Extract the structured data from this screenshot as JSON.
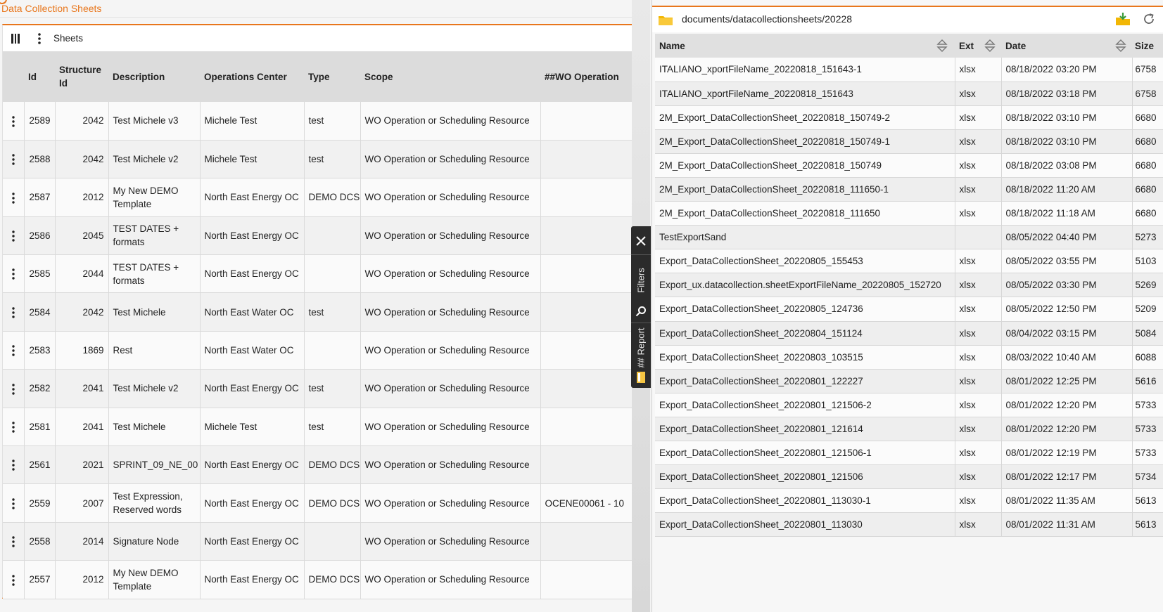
{
  "app": {
    "title": "Data Collection Sheets"
  },
  "toolbar": {
    "title": "Sheets"
  },
  "sheets": {
    "columns": [
      "Id",
      "Structure Id",
      "Description",
      "Operations Center",
      "Type",
      "Scope",
      "##WO Operation"
    ],
    "rows": [
      [
        "2589",
        "2042",
        "Test Michele v3",
        "Michele Test",
        "test",
        "WO Operation or Scheduling Resource",
        ""
      ],
      [
        "2588",
        "2042",
        "Test Michele v2",
        "Michele Test",
        "test",
        "WO Operation or Scheduling Resource",
        ""
      ],
      [
        "2587",
        "2012",
        "My New DEMO Template",
        "North East Energy OC",
        "DEMO DCS",
        "WO Operation or Scheduling Resource",
        ""
      ],
      [
        "2586",
        "2045",
        "TEST DATES + formats",
        "North East Energy OC",
        "",
        "WO Operation or Scheduling Resource",
        ""
      ],
      [
        "2585",
        "2044",
        "TEST DATES + formats",
        "North East Energy OC",
        "",
        "WO Operation or Scheduling Resource",
        ""
      ],
      [
        "2584",
        "2042",
        "Test Michele",
        "North East Water OC",
        "test",
        "WO Operation or Scheduling Resource",
        ""
      ],
      [
        "2583",
        "1869",
        "Rest",
        "North East Water OC",
        "",
        "WO Operation or Scheduling Resource",
        ""
      ],
      [
        "2582",
        "2041",
        "Test Michele v2",
        "North East Energy OC",
        "test",
        "WO Operation or Scheduling Resource",
        ""
      ],
      [
        "2581",
        "2041",
        "Test Michele",
        "Michele Test",
        "test",
        "WO Operation or Scheduling Resource",
        ""
      ],
      [
        "2561",
        "2021",
        "SPRINT_09_NE_00",
        "North East Energy OC",
        "DEMO DCS",
        "WO Operation or Scheduling Resource",
        ""
      ],
      [
        "2559",
        "2007",
        "Test Expression, Reserved words",
        "North East Energy OC",
        "DEMO DCS",
        "WO Operation or Scheduling Resource",
        "OCENE00061 - 10"
      ],
      [
        "2558",
        "2014",
        "Signature Node",
        "North East Energy OC",
        "",
        "WO Operation or Scheduling Resource",
        ""
      ],
      [
        "2557",
        "2012",
        "My New DEMO Template",
        "North East Energy OC",
        "DEMO DCS",
        "WO Operation or Scheduling Resource",
        ""
      ]
    ]
  },
  "side_tabs": {
    "filters": "Filters",
    "report": "## Report"
  },
  "file_browser": {
    "path": "documents/datacollectionsheets/20228",
    "columns": [
      "Name",
      "Ext",
      "Date",
      "Size"
    ],
    "rows": [
      [
        "ITALIANO_xportFileName_20220818_151643-1",
        "xlsx",
        "08/18/2022 03:20 PM",
        "6758"
      ],
      [
        "ITALIANO_xportFileName_20220818_151643",
        "xlsx",
        "08/18/2022 03:18 PM",
        "6758"
      ],
      [
        "2M_Export_DataCollectionSheet_20220818_150749-2",
        "xlsx",
        "08/18/2022 03:10 PM",
        "6680"
      ],
      [
        "2M_Export_DataCollectionSheet_20220818_150749-1",
        "xlsx",
        "08/18/2022 03:10 PM",
        "6680"
      ],
      [
        "2M_Export_DataCollectionSheet_20220818_150749",
        "xlsx",
        "08/18/2022 03:08 PM",
        "6680"
      ],
      [
        "2M_Export_DataCollectionSheet_20220818_111650-1",
        "xlsx",
        "08/18/2022 11:20 AM",
        "6680"
      ],
      [
        "2M_Export_DataCollectionSheet_20220818_111650",
        "xlsx",
        "08/18/2022 11:18 AM",
        "6680"
      ],
      [
        "TestExportSand",
        "",
        "08/05/2022 04:40 PM",
        "5273"
      ],
      [
        "Export_DataCollectionSheet_20220805_155453",
        "xlsx",
        "08/05/2022 03:55 PM",
        "5103"
      ],
      [
        "Export_ux.datacollection.sheetExportFileName_20220805_152720",
        "xlsx",
        "08/05/2022 03:30 PM",
        "5269"
      ],
      [
        "Export_DataCollectionSheet_20220805_124736",
        "xlsx",
        "08/05/2022 12:50 PM",
        "5209"
      ],
      [
        "Export_DataCollectionSheet_20220804_151124",
        "xlsx",
        "08/04/2022 03:15 PM",
        "5084"
      ],
      [
        "Export_DataCollectionSheet_20220803_103515",
        "xlsx",
        "08/03/2022 10:40 AM",
        "6088"
      ],
      [
        "Export_DataCollectionSheet_20220801_122227",
        "xlsx",
        "08/01/2022 12:25 PM",
        "5616"
      ],
      [
        "Export_DataCollectionSheet_20220801_121506-2",
        "xlsx",
        "08/01/2022 12:20 PM",
        "5733"
      ],
      [
        "Export_DataCollectionSheet_20220801_121614",
        "xlsx",
        "08/01/2022 12:20 PM",
        "5733"
      ],
      [
        "Export_DataCollectionSheet_20220801_121506-1",
        "xlsx",
        "08/01/2022 12:19 PM",
        "5733"
      ],
      [
        "Export_DataCollectionSheet_20220801_121506",
        "xlsx",
        "08/01/2022 12:17 PM",
        "5734"
      ],
      [
        "Export_DataCollectionSheet_20220801_113030-1",
        "xlsx",
        "08/01/2022 11:35 AM",
        "5613"
      ],
      [
        "Export_DataCollectionSheet_20220801_113030",
        "xlsx",
        "08/01/2022 11:31 AM",
        "5613"
      ]
    ]
  },
  "colors": {
    "accent": "#e8761c",
    "side_toolbar": "#2b2b2b",
    "header_bg": "#dcdcdc"
  }
}
